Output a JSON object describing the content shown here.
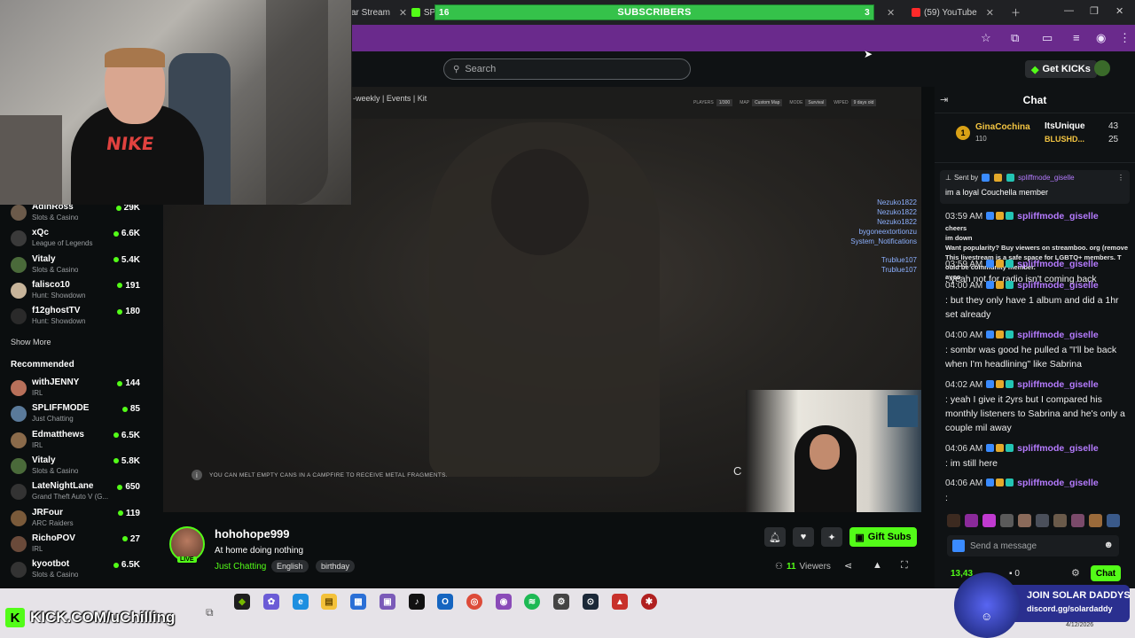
{
  "browser": {
    "tabs": [
      {
        "label": "ar Stream"
      },
      {
        "label": "SPI"
      },
      {
        "label": "(59) YouTube"
      }
    ],
    "subscriber_bar": {
      "left": "16",
      "label": "SUBSCRIBERS",
      "right": "3"
    }
  },
  "header": {
    "search_placeholder": "Search",
    "get_kicks": "Get KICKs"
  },
  "sidebar": {
    "following": [
      {
        "name": "AdinRoss",
        "category": "Slots & Casino",
        "viewers": "29K",
        "color": "#6b5a4a"
      },
      {
        "name": "xQc",
        "category": "League of Legends",
        "viewers": "6.6K",
        "color": "#3a3a3a"
      },
      {
        "name": "Vitaly",
        "category": "Slots & Casino",
        "viewers": "5.4K",
        "color": "#4a6a3a"
      },
      {
        "name": "falisco10",
        "category": "Hunt: Showdown",
        "viewers": "191",
        "color": "#c7b49a"
      },
      {
        "name": "f12ghostTV",
        "category": "Hunt: Showdown",
        "viewers": "180",
        "color": "#2a2a2a"
      }
    ],
    "show_more": "Show More",
    "recommended_title": "Recommended",
    "recommended": [
      {
        "name": "withJENNY",
        "category": "IRL",
        "viewers": "144",
        "color": "#b8705a"
      },
      {
        "name": "SPLIFFMODE",
        "category": "Just Chatting",
        "viewers": "85",
        "color": "#5a7a9a"
      },
      {
        "name": "Edmatthews",
        "category": "IRL",
        "viewers": "6.5K",
        "color": "#8a6a4a"
      },
      {
        "name": "Vitaly",
        "category": "Slots & Casino",
        "viewers": "5.8K",
        "color": "#4a6a3a"
      },
      {
        "name": "LateNightLane",
        "category": "Grand Theft Auto V (G...",
        "viewers": "650",
        "color": "#333"
      },
      {
        "name": "JRFour",
        "category": "ARC Raiders",
        "viewers": "119",
        "color": "#7a5a3a"
      },
      {
        "name": "RichoPOV",
        "category": "IRL",
        "viewers": "27",
        "color": "#6a4a3a"
      },
      {
        "name": "kyootbot",
        "category": "Slots & Casino",
        "viewers": "6.5K",
        "color": "#333"
      }
    ]
  },
  "player": {
    "hud_title": "-weekly | Events | Kit",
    "stats": [
      {
        "label": "PLAYERS",
        "value": "1/300"
      },
      {
        "label": "MAP",
        "value": "Custom Map"
      },
      {
        "label": "MODE",
        "value": "Survival"
      },
      {
        "label": "WIPED",
        "value": "9 days old"
      }
    ],
    "killfeed": [
      "Nezuko1822",
      "Nezuko1822",
      "Nezuko1822",
      "bygoneextortionzu",
      "System_Notifications",
      "Trublue107",
      "Trublue107"
    ],
    "tip": "YOU CAN MELT EMPTY CANS IN A CAMPFIRE TO RECEIVE METAL FRAGMENTS.",
    "letter": "C"
  },
  "stream": {
    "streamer": "hohohope999",
    "live": "LIVE",
    "title": "At home doing nothing",
    "category": "Just Chatting",
    "tags": [
      "English",
      "birthday"
    ],
    "gift_subs": "Gift Subs",
    "viewers": "11",
    "viewers_label": "Viewers"
  },
  "chat": {
    "title": "Chat",
    "gifters": [
      {
        "rank": "1",
        "name": "GinaCochina",
        "count": "110"
      },
      {
        "name": "ItsUnique",
        "count": "43"
      },
      {
        "name": "BLUSHD...",
        "count": "25"
      }
    ],
    "pinned": {
      "sent_by": "Sent by",
      "user": "spliffmode_giselle",
      "message": "im a loyal Couchella member"
    },
    "overlay": [
      "cheers",
      "im down",
      "Want popularity? Buy viewers on streamboo. org (remove",
      "This livestream is a safe space for LGBTQ+ members. T",
      "ould be community member.",
      "ayoo"
    ],
    "messages": [
      {
        "time": "03:59 AM",
        "user": "spliffmode_giselle",
        "text": ""
      },
      {
        "time": "03:59 AM",
        "user": "spliffmode_giselle",
        "text": ": yeah not for radio isn't coming back"
      },
      {
        "time": "04:00 AM",
        "user": "spliffmode_giselle",
        "text": ": but they only have 1 album and did a 1hr set already"
      },
      {
        "time": "04:00 AM",
        "user": "spliffmode_giselle",
        "text": ": sombr was good he pulled a \"I'll be back when I'm headlining\" like Sabrina"
      },
      {
        "time": "04:02 AM",
        "user": "spliffmode_giselle",
        "text": ": yeah I give it 2yrs but I compared his monthly listeners to Sabrina and he's only a couple mil away"
      },
      {
        "time": "04:06 AM",
        "user": "spliffmode_giselle",
        "text": ": im still here"
      },
      {
        "time": "04:06 AM",
        "user": "spliffmode_giselle",
        "text": ":"
      }
    ],
    "send_placeholder": "Send a message",
    "points": "13,43",
    "zero": "0",
    "chat_button": "Chat"
  },
  "taskbar": {
    "kick_url": "KICK.COM/uChilling",
    "discord_title": "JOIN SOLAR DADDYS",
    "discord_link": "discord.gg/solardaddy",
    "clock": "4/12/2026"
  }
}
